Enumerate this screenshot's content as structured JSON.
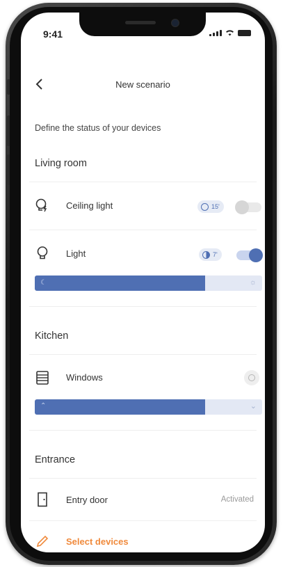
{
  "status_bar": {
    "time": "9:41"
  },
  "header": {
    "title": "New scenario"
  },
  "subtitle": "Define the status of your devices",
  "rooms": {
    "living_room": {
      "name": "Living room",
      "devices": [
        {
          "name": "Ceiling light",
          "icon": "bulb-flash-icon",
          "timer": "15'",
          "on": false
        },
        {
          "name": "Light",
          "icon": "bulb-icon",
          "timer": "7'",
          "on": true,
          "level": 0.75
        }
      ]
    },
    "kitchen": {
      "name": "Kitchen",
      "devices": [
        {
          "name": "Windows",
          "icon": "window-blind-icon",
          "level": 0.75
        }
      ]
    },
    "entrance": {
      "name": "Entrance",
      "devices": [
        {
          "name": "Entry door",
          "icon": "door-icon",
          "status": "Activated"
        }
      ]
    }
  },
  "actions": {
    "select_devices": "Select devices"
  },
  "colors": {
    "accent": "#4f6fb3",
    "action": "#f08a3c",
    "track": "#e3e8f4"
  }
}
